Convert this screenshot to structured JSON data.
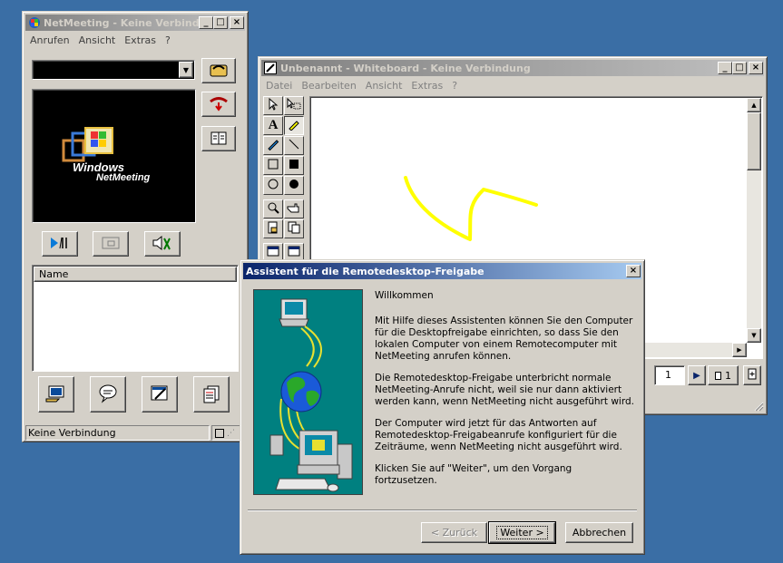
{
  "desktop": {
    "background": "#3a6ea5"
  },
  "netmeeting": {
    "title": "NetMeeting - Keine Verbindu...",
    "menu": [
      "Anrufen",
      "Ansicht",
      "Extras",
      "?"
    ],
    "address_value": "",
    "logo_line1": "Windows",
    "logo_line2": "NetMeeting",
    "list_header": "Name",
    "status": "Keine Verbindung",
    "icons": {
      "call": "phone-book-icon",
      "hangup": "hang-up-icon",
      "directory": "address-book-icon",
      "play": "play-pause-icon",
      "pip": "picture-in-picture-icon",
      "audio": "audio-volume-icon",
      "share": "share-program-icon",
      "chat": "chat-icon",
      "whiteboard": "whiteboard-icon",
      "transfer": "file-transfer-icon"
    }
  },
  "whiteboard": {
    "title": "Unbenannt - Whiteboard - Keine Verbindung",
    "menu": [
      "Datei",
      "Bearbeiten",
      "Ansicht",
      "Extras",
      "?"
    ],
    "page_number": "1",
    "page_count": "1",
    "stroke_color": "#ffff00"
  },
  "wizard": {
    "title": "Assistent für die Remotedesktop-Freigabe",
    "heading": "Willkommen",
    "para1": "Mit Hilfe dieses Assistenten können Sie den Computer für die Desktopfreigabe einrichten, so dass Sie den lokalen Computer von einem Remotecomputer mit NetMeeting anrufen können.",
    "para2": "Die Remotedesktop-Freigabe unterbricht normale NetMeeting-Anrufe nicht, weil sie nur dann aktiviert werden kann, wenn NetMeeting nicht ausgeführt wird.",
    "para3": "Der Computer wird jetzt für das Antworten auf Remotedesktop-Freigabeanrufe konfiguriert für die Zeiträume, wenn NetMeeting nicht ausgeführt wird.",
    "para4": "Klicken Sie auf \"Weiter\", um den Vorgang fortzusetzen.",
    "back_label": "< Zurück",
    "next_label": "Weiter >",
    "cancel_label": "Abbrechen",
    "image_bg": "#008080"
  }
}
